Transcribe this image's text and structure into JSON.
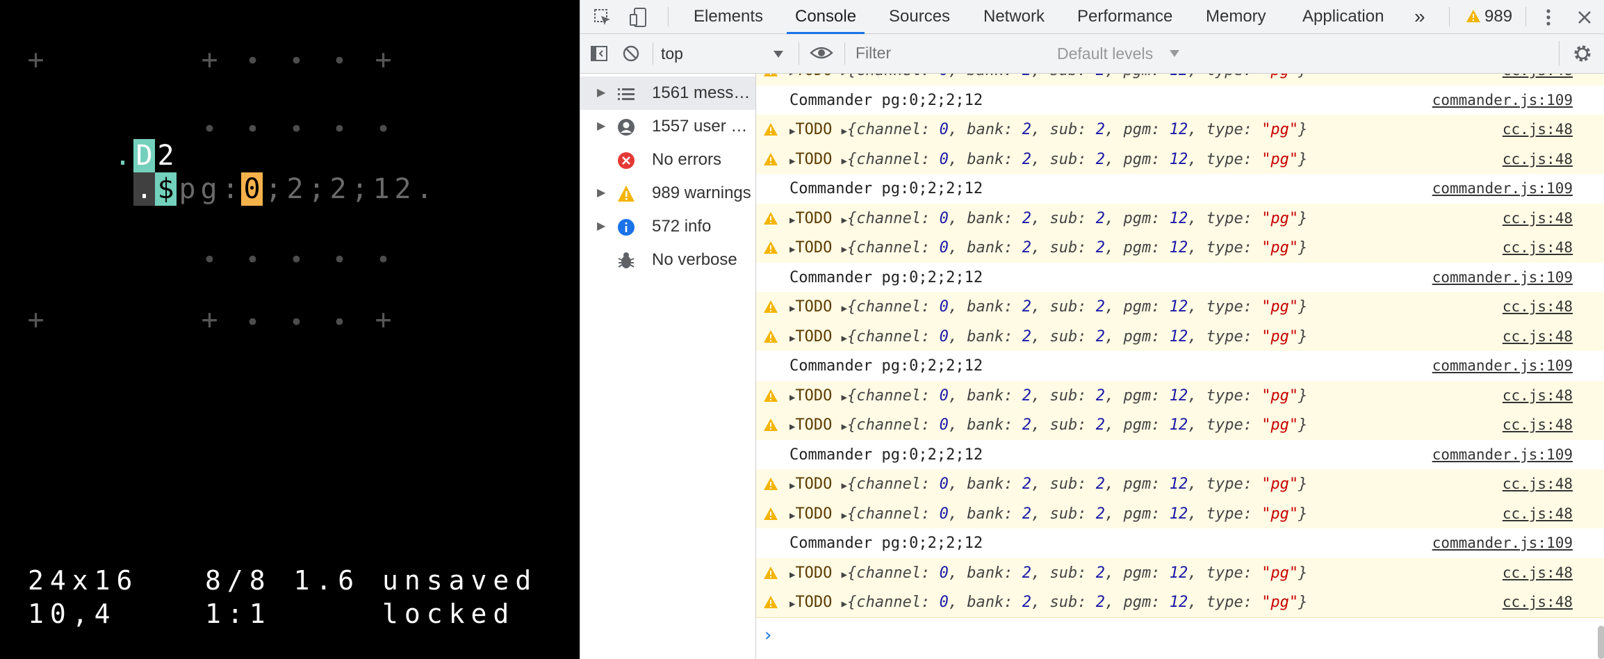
{
  "orca": {
    "status_line1": "24x16   8/8 1.6 unsaved",
    "status_line2": "10,4    1:1     locked",
    "marker_plus": "+",
    "marker_dot": "•",
    "cells": {
      "dot1": ".",
      "d_op": "D",
      "d_arg": "2",
      "dot2": ".",
      "dollar": "$",
      "p": "p",
      "g": "g",
      "colon": ":",
      "zero": "0",
      "semi1": ";",
      "two1": "2",
      "semi2": ";",
      "two2": "2",
      "semi3": ";",
      "one": "1",
      "two3": "2",
      "period": "."
    }
  },
  "devtools": {
    "tabs": [
      "Elements",
      "Console",
      "Sources",
      "Network",
      "Performance",
      "Memory",
      "Application"
    ],
    "active_tab": "Console",
    "more_tabs": "»",
    "warning_count": "989",
    "context": "top",
    "filter_placeholder": "Filter",
    "levels": "Default levels",
    "sidebar": [
      {
        "label": "1561 mess…",
        "icon": "list-icon",
        "expandable": true
      },
      {
        "label": "1557 user …",
        "icon": "user-icon",
        "expandable": true
      },
      {
        "label": "No errors",
        "icon": "error-icon",
        "expandable": false
      },
      {
        "label": "989 warnings",
        "icon": "warning-icon",
        "expandable": true
      },
      {
        "label": "572 info",
        "icon": "info-icon",
        "expandable": true
      },
      {
        "label": "No verbose",
        "icon": "bug-icon",
        "expandable": false
      }
    ],
    "todo_label": "TODO",
    "todo_object": {
      "channel": "0",
      "bank": "2",
      "sub": "2",
      "pgm": "12",
      "type": "\"pg\""
    },
    "commander_message": "Commander pg:0;2;2;12",
    "commander_source": "commander.js:109",
    "cc_source": "cc.js:48",
    "rows": [
      "warn",
      "log",
      "warn",
      "warn",
      "log",
      "warn",
      "warn",
      "log",
      "warn",
      "warn",
      "log",
      "warn",
      "warn",
      "log",
      "warn",
      "warn",
      "log",
      "warn",
      "warn"
    ],
    "prompt": "›",
    "colors": {
      "accent": "#1a73e8",
      "warning_bg": "#fffbe5",
      "orca_teal": "#73d0bd",
      "orca_cursor": "#f6b24a"
    }
  }
}
